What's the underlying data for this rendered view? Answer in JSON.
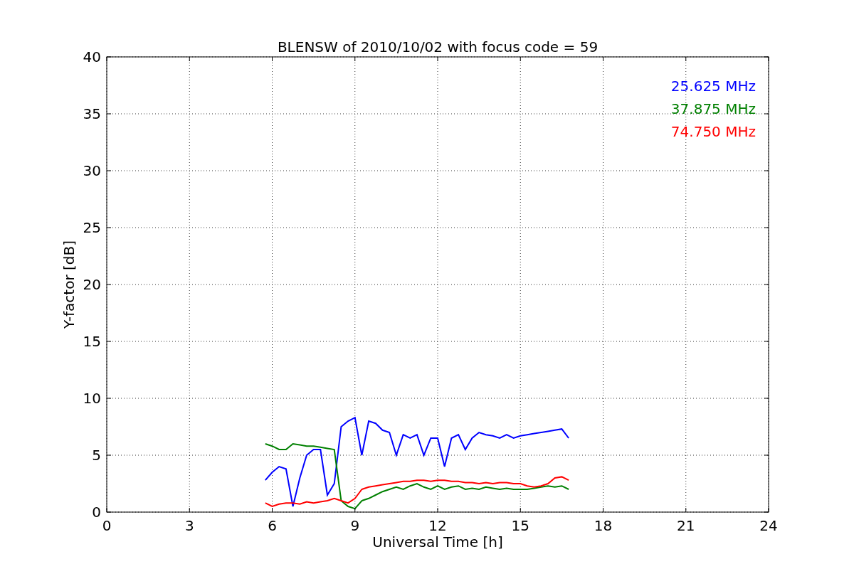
{
  "figure": {
    "chart_data": {
      "type": "line",
      "title": "BLENSW of 2010/10/02 with focus code = 59",
      "xlabel": "Universal Time [h]",
      "ylabel": "Y-factor [dB]",
      "x": [
        5.75,
        6,
        6.25,
        6.5,
        6.75,
        7,
        7.25,
        7.5,
        7.75,
        8,
        8.25,
        8.5,
        8.75,
        9,
        9.25,
        9.5,
        9.75,
        10,
        10.25,
        10.5,
        10.75,
        11,
        11.25,
        11.5,
        11.75,
        12,
        12.25,
        12.5,
        12.75,
        13,
        13.25,
        13.5,
        13.75,
        14,
        14.25,
        14.5,
        14.75,
        15,
        15.25,
        15.5,
        15.75,
        16,
        16.25,
        16.5,
        16.75
      ],
      "series": [
        {
          "name": "25.625 MHz",
          "color": "#0000ff",
          "values": [
            2.8,
            3.5,
            4,
            3.8,
            0.5,
            3,
            5,
            5.5,
            5.5,
            1.5,
            2.5,
            7.5,
            8,
            8.3,
            5,
            8,
            7.8,
            7.2,
            7,
            5,
            6.8,
            6.5,
            6.8,
            5,
            6.5,
            6.5,
            4,
            6.5,
            6.8,
            5.5,
            6.5,
            7,
            6.8,
            6.7,
            6.5,
            6.8,
            6.5,
            6.7,
            6.8,
            6.9,
            7,
            7.1,
            7.2,
            7.3,
            6.5
          ]
        },
        {
          "name": "37.875 MHz",
          "color": "#008000",
          "values": [
            6,
            5.8,
            5.5,
            5.5,
            6,
            5.9,
            5.8,
            5.8,
            5.7,
            5.6,
            5.5,
            1,
            0.5,
            0.3,
            1,
            1.2,
            1.5,
            1.8,
            2,
            2.2,
            2,
            2.3,
            2.5,
            2.2,
            2,
            2.3,
            2,
            2.2,
            2.3,
            2,
            2.1,
            2,
            2.2,
            2.1,
            2,
            2.1,
            2,
            2,
            2,
            2.1,
            2.2,
            2.3,
            2.2,
            2.3,
            2
          ]
        },
        {
          "name": "74.750 MHz",
          "color": "#ff0000",
          "values": [
            0.8,
            0.5,
            0.7,
            0.8,
            0.8,
            0.7,
            0.9,
            0.8,
            0.9,
            1,
            1.2,
            1,
            0.8,
            1.2,
            2,
            2.2,
            2.3,
            2.4,
            2.5,
            2.6,
            2.7,
            2.7,
            2.8,
            2.8,
            2.7,
            2.8,
            2.8,
            2.7,
            2.7,
            2.6,
            2.6,
            2.5,
            2.6,
            2.5,
            2.6,
            2.6,
            2.5,
            2.5,
            2.3,
            2.2,
            2.3,
            2.5,
            3,
            3.1,
            2.8
          ]
        }
      ],
      "xlim": [
        0,
        24
      ],
      "ylim": [
        0,
        40
      ],
      "xticks": [
        0,
        3,
        6,
        9,
        12,
        15,
        18,
        21,
        24
      ],
      "yticks": [
        0,
        5,
        10,
        15,
        20,
        25,
        30,
        35,
        40
      ],
      "grid": true
    }
  }
}
